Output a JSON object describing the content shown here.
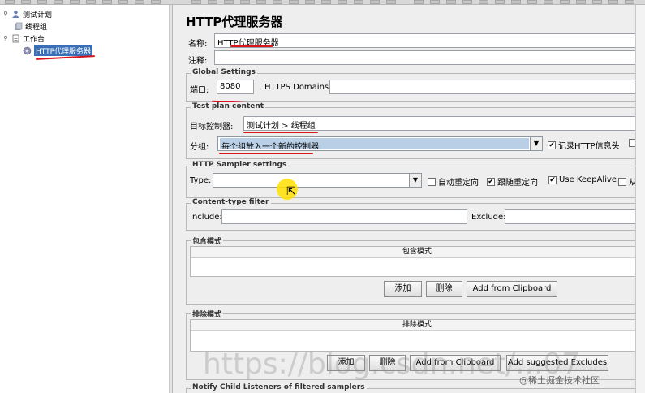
{
  "tree": {
    "items": [
      {
        "label": "测试计划"
      },
      {
        "label": "线程组"
      },
      {
        "label": "工作台"
      },
      {
        "label": "HTTP代理服务器"
      }
    ]
  },
  "page": {
    "title": "HTTP代理服务器",
    "name_label": "名称:",
    "name_value": "HTTP代理服务器",
    "comment_label": "注释:",
    "comment_value": ""
  },
  "global": {
    "title": "Global Settings",
    "port_label": "端口:",
    "port_value": "8080",
    "https_label": "HTTPS Domains :",
    "https_value": ""
  },
  "testplan": {
    "title": "Test plan content",
    "target_label": "目标控制器:",
    "target_value": "测试计划 > 线程组",
    "group_label": "分组:",
    "group_value": "每个组放入一个新的控制器",
    "record_headers_label": "记录HTTP信息头"
  },
  "sampler": {
    "title": "HTTP Sampler settings",
    "type_label": "Type:",
    "type_value": "",
    "auto_redirect_label": "自动重定向",
    "follow_redirect_label": "跟随重定向",
    "keepalive_label": "Use KeepAlive",
    "extra_label": "从"
  },
  "content_filter": {
    "title": "Content-type filter",
    "include_label": "Include:",
    "include_value": "",
    "exclude_label": "Exclude:",
    "exclude_value": ""
  },
  "include_patterns": {
    "title": "包含模式",
    "column": "包含模式",
    "add_label": "添加",
    "delete_label": "删除",
    "clipboard_label": "Add from Clipboard"
  },
  "exclude_patterns": {
    "title": "排除模式",
    "column": "排除模式",
    "add_label": "添加",
    "delete_label": "删除",
    "clipboard_label": "Add from Clipboard",
    "suggested_label": "Add suggested Excludes"
  },
  "notify": {
    "title": "Notify Child Listeners of filtered samplers"
  },
  "overlay": {
    "watermark": "https://blog.csdn.net/...07",
    "credit": "@稀土掘金技术社区"
  },
  "colors": {
    "annotation": "#d8141c",
    "selection": "#3a6fb8",
    "cursor_highlight": "#ffe000"
  }
}
